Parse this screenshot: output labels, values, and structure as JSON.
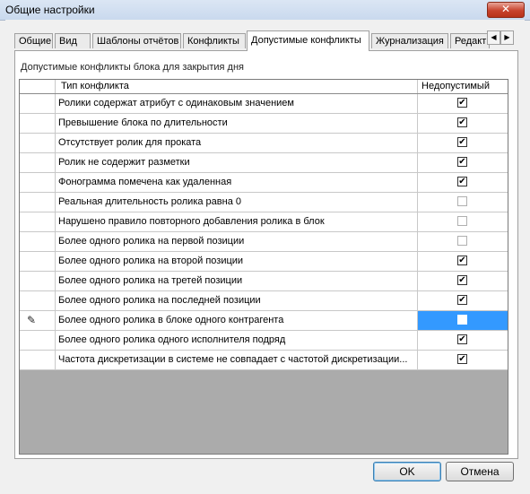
{
  "window": {
    "title": "Общие настройки",
    "close_glyph": "✕"
  },
  "tabs": [
    {
      "label": "Общие"
    },
    {
      "label": "Вид"
    },
    {
      "label": "Шаблоны отчётов"
    },
    {
      "label": "Конфликты"
    },
    {
      "label": "Допустимые конфликты",
      "active": true
    },
    {
      "label": "Журнализация"
    },
    {
      "label": "Редакт"
    }
  ],
  "tab_scroll": {
    "left": "◀",
    "right": "▶"
  },
  "panel": {
    "section_label": "Допустимые конфликты блока для закрытия дня"
  },
  "grid": {
    "columns": {
      "type": "Тип конфликта",
      "forbidden": "Недопустимый"
    },
    "rows": [
      {
        "name": "Ролики содержат атрибут с одинаковым значением",
        "checked": true
      },
      {
        "name": "Превышение блока по длительности",
        "checked": true
      },
      {
        "name": "Отсутствует ролик для проката",
        "checked": true
      },
      {
        "name": "Ролик не содержит разметки",
        "checked": true
      },
      {
        "name": "Фонограмма помечена как удаленная",
        "checked": true
      },
      {
        "name": "Реальная длительность ролика равна 0",
        "checked": false
      },
      {
        "name": "Нарушено правило повторного добавления ролика в блок",
        "checked": false
      },
      {
        "name": "Более одного ролика на первой позиции",
        "checked": false
      },
      {
        "name": "Более одного ролика на второй позиции",
        "checked": true
      },
      {
        "name": "Более одного ролика на третей позиции",
        "checked": true
      },
      {
        "name": "Более одного ролика на последней позиции",
        "checked": true
      },
      {
        "name": "Более одного ролика в блоке одного контрагента",
        "checked": false,
        "editing": true,
        "selected": true
      },
      {
        "name": "Более одного ролика одного исполнителя подряд",
        "checked": true
      },
      {
        "name": "Частота дискретизации в системе не совпадает с частотой дискретизации...",
        "checked": true
      }
    ],
    "check_glyph": "✔",
    "edit_icon": "pencil-icon",
    "selection_color": "#3399ff"
  },
  "buttons": {
    "ok": "OK",
    "cancel": "Отмена"
  }
}
